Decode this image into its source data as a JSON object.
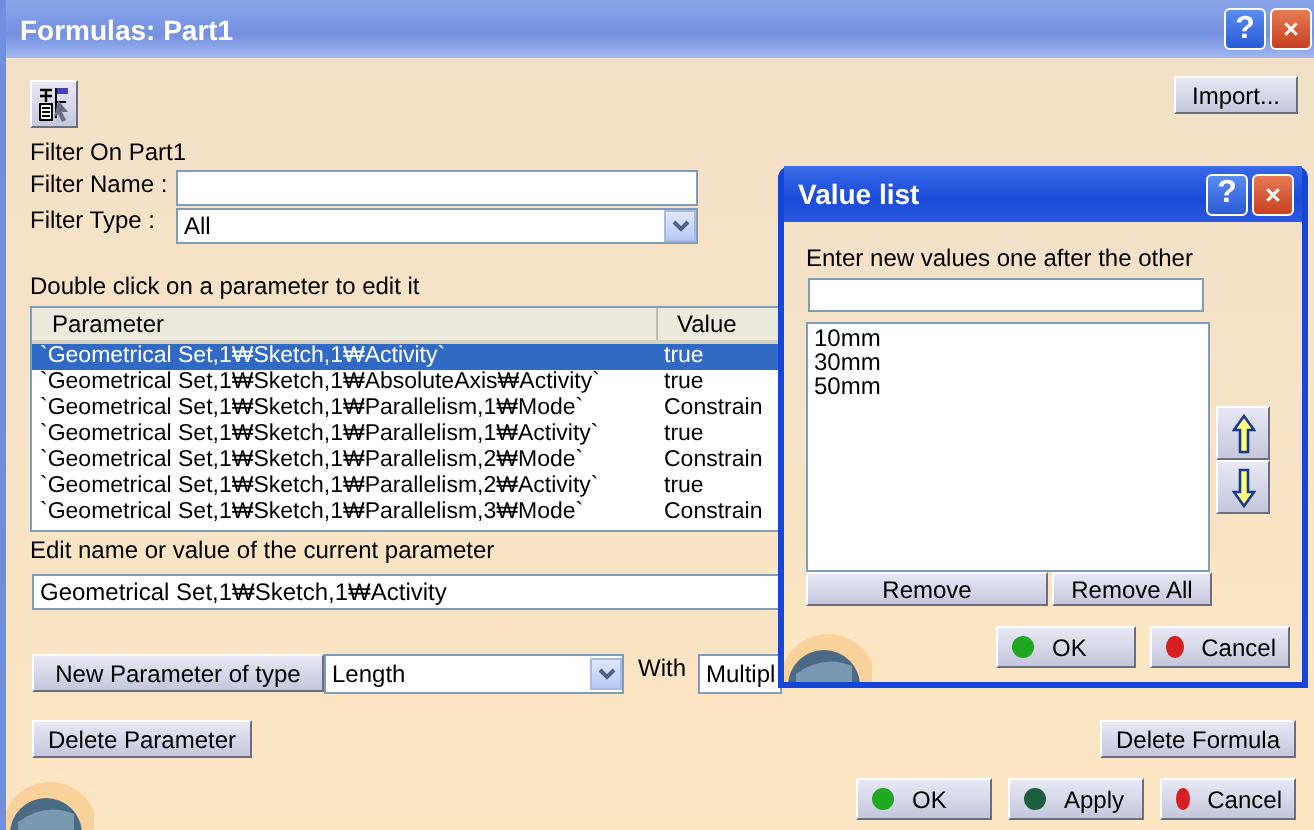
{
  "window": {
    "title": "Formulas: Part1",
    "help": "?"
  },
  "import_button": "Import...",
  "filter": {
    "title": "Filter On Part1",
    "name_label": "Filter Name :",
    "type_label": "Filter Type :",
    "type_value": "All"
  },
  "table": {
    "caption": "Double click on a parameter to edit it",
    "columns": [
      "Parameter",
      "Value"
    ],
    "rows": [
      {
        "parameter": "`Geometrical Set,1₩Sketch,1₩Activity`",
        "value": "true",
        "selected": true
      },
      {
        "parameter": "`Geometrical Set,1₩Sketch,1₩AbsoluteAxis₩Activity`",
        "value": "true",
        "selected": false
      },
      {
        "parameter": "`Geometrical Set,1₩Sketch,1₩Parallelism,1₩Mode`",
        "value": "Constrain",
        "selected": false
      },
      {
        "parameter": "`Geometrical Set,1₩Sketch,1₩Parallelism,1₩Activity`",
        "value": "true",
        "selected": false
      },
      {
        "parameter": "`Geometrical Set,1₩Sketch,1₩Parallelism,2₩Mode`",
        "value": "Constrain",
        "selected": false
      },
      {
        "parameter": "`Geometrical Set,1₩Sketch,1₩Parallelism,2₩Activity`",
        "value": "true",
        "selected": false
      },
      {
        "parameter": "`Geometrical Set,1₩Sketch,1₩Parallelism,3₩Mode`",
        "value": "Constrain",
        "selected": false
      }
    ]
  },
  "edit": {
    "label": "Edit name or value of the current parameter",
    "value": "Geometrical Set,1₩Sketch,1₩Activity"
  },
  "new_parameter": {
    "button": "New Parameter of type",
    "type": "Length",
    "with_label": "With",
    "with_value": "Multipl"
  },
  "delete_parameter": "Delete Parameter",
  "delete_formula": "Delete Formula",
  "buttons": [
    {
      "label": "OK",
      "color": "#1fa81f"
    },
    {
      "label": "Apply",
      "color": "#1d5e40"
    },
    {
      "label": "Cancel",
      "color": "#d42020"
    }
  ],
  "dialog": {
    "title": "Value list",
    "help": "?",
    "prompt": "Enter new values one after the other",
    "values": [
      "10mm",
      "30mm",
      "50mm"
    ],
    "remove": "Remove",
    "remove_all": "Remove All",
    "buttons": [
      {
        "label": "OK",
        "color": "#1fa81f"
      },
      {
        "label": "Cancel",
        "color": "#d42020"
      }
    ]
  }
}
